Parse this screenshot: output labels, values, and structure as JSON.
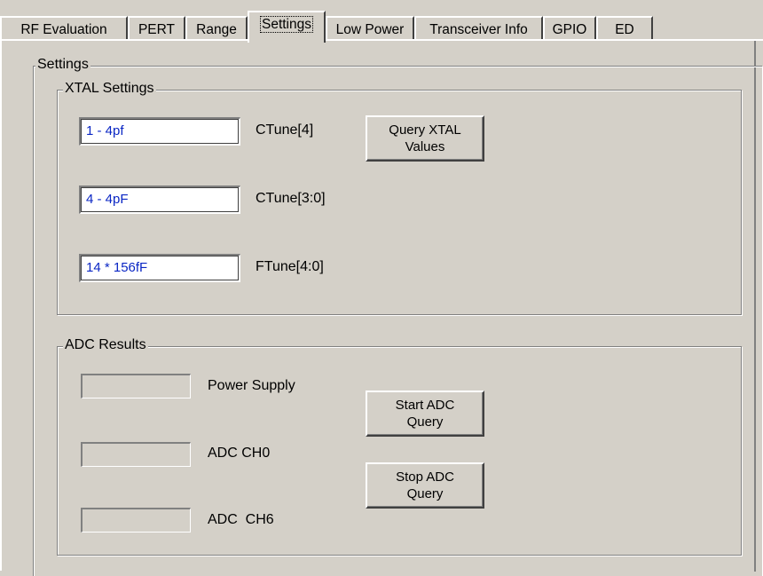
{
  "tabs": [
    {
      "label": "RF Evaluation",
      "active": false
    },
    {
      "label": "PERT",
      "active": false
    },
    {
      "label": "Range",
      "active": false
    },
    {
      "label": "Settings",
      "active": true
    },
    {
      "label": "Low Power",
      "active": false
    },
    {
      "label": "Transceiver Info",
      "active": false
    },
    {
      "label": "GPIO",
      "active": false
    },
    {
      "label": "ED",
      "active": false
    }
  ],
  "settings": {
    "title": "Settings",
    "xtal": {
      "title": "XTAL Settings",
      "ctune4": {
        "value": "1 - 4pf",
        "label": "CTune[4]"
      },
      "ctune30": {
        "value": "4 - 4pF",
        "label": "CTune[3:0]"
      },
      "ftune": {
        "value": "14 * 156fF",
        "label": "FTune[4:0]"
      },
      "query_button": "Query XTAL\nValues"
    },
    "adc": {
      "title": "ADC Results",
      "power_supply": {
        "value": "",
        "label": "Power Supply"
      },
      "ch0": {
        "value": "",
        "label": "ADC CH0"
      },
      "ch6": {
        "value": "",
        "label": "ADC  CH6"
      },
      "start_button": "Start ADC\nQuery",
      "stop_button": "Stop ADC\nQuery"
    }
  },
  "colors": {
    "background": "#d4d0c8",
    "field_text": "#0a26c4"
  }
}
